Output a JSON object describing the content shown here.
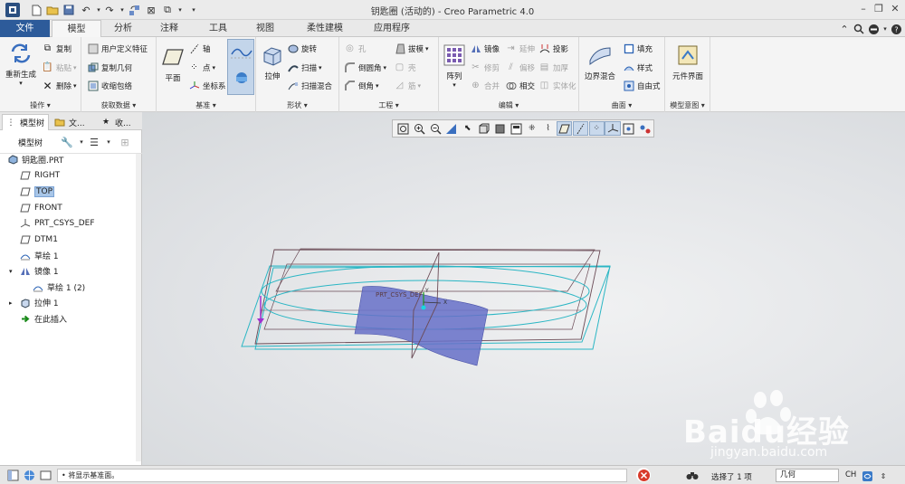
{
  "window": {
    "title": "钥匙圈 (活动的) - Creo Parametric 4.0"
  },
  "tabs": [
    {
      "label": "文件"
    },
    {
      "label": "模型"
    },
    {
      "label": "分析"
    },
    {
      "label": "注释"
    },
    {
      "label": "工具"
    },
    {
      "label": "视图"
    },
    {
      "label": "柔性建模"
    },
    {
      "label": "应用程序"
    }
  ],
  "ribbon": {
    "operations": {
      "label": "操作",
      "regenerate": "重新生成",
      "copy": "复制",
      "paste": "粘贴",
      "delete": "删除"
    },
    "get_data": {
      "label": "获取数据",
      "udf": "用户定义特征",
      "copy_geom": "复制几何",
      "shrinkwrap": "收缩包络"
    },
    "datum": {
      "label": "基准",
      "plane": "平面",
      "axis": "轴",
      "point": "点",
      "csys": "坐标系"
    },
    "shapes": {
      "label": "形状",
      "extrude": "拉伸",
      "revolve": "旋转",
      "sweep": "扫描",
      "swept_blend": "扫描混合"
    },
    "engineering": {
      "label": "工程",
      "hole": "孔",
      "round": "倒圆角",
      "chamfer": "倒角",
      "draft": "拔模",
      "shell": "壳",
      "rib": "筋"
    },
    "editing": {
      "label": "编辑",
      "pattern": "阵列",
      "mirror": "镜像",
      "trim": "修剪",
      "merge": "合并",
      "extend": "延伸",
      "offset": "偏移",
      "intersect": "相交",
      "project": "投影",
      "thicken": "加厚",
      "solidify": "实体化"
    },
    "surfaces": {
      "label": "曲面",
      "boundary": "边界混合",
      "fill": "填充",
      "style": "样式",
      "freestyle": "自由式"
    },
    "intent": {
      "label": "模型意图",
      "component_interface": "元件界面"
    }
  },
  "panel": {
    "tabs": [
      "模型树",
      "文...",
      "收..."
    ],
    "toolbar_label": "模型树",
    "tree": [
      {
        "label": "钥匙圈.PRT",
        "icon": "part-icon"
      },
      {
        "label": "RIGHT",
        "icon": "datum-plane-icon"
      },
      {
        "label": "TOP",
        "icon": "datum-plane-icon",
        "selected": true
      },
      {
        "label": "FRONT",
        "icon": "datum-plane-icon"
      },
      {
        "label": "PRT_CSYS_DEF",
        "icon": "csys-icon"
      },
      {
        "label": "DTM1",
        "icon": "datum-plane-icon"
      },
      {
        "label": "草绘 1",
        "icon": "sketch-icon"
      },
      {
        "label": "镜像 1",
        "icon": "mirror-icon",
        "expanded": true
      },
      {
        "label": "草绘 1 (2)",
        "icon": "sketch-icon"
      },
      {
        "label": "拉伸 1",
        "icon": "extrude-icon",
        "collapsed": true
      },
      {
        "label": "在此插入",
        "icon": "insert-here-icon"
      }
    ]
  },
  "viewport": {
    "csys_label": "PRT_CSYS_DEF",
    "axis_x": "X",
    "axis_y": "Y"
  },
  "status": {
    "message": "• 将显示基准面。",
    "selection": "选择了 1 项",
    "filter": "几何",
    "lang": "CH"
  },
  "watermark": {
    "brand": "Baidu经验",
    "url": "jingyan.baidu.com"
  },
  "colors": {
    "file_tab": "#2d5b9a",
    "selection": "#a8c6e8",
    "surface": "#6670c8",
    "datum": "#2ab6c4",
    "frame": "#6a4a55"
  }
}
